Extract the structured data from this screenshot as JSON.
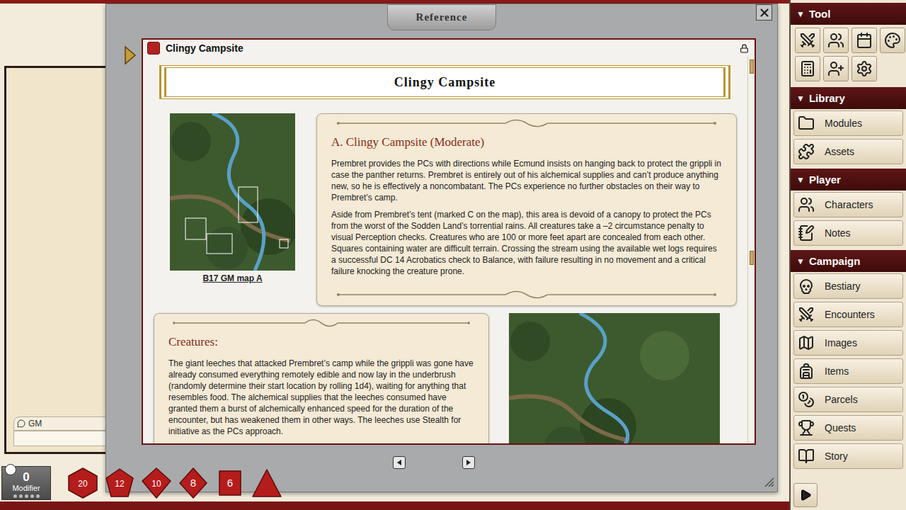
{
  "reference_window": {
    "title": "Reference"
  },
  "record": {
    "title": "Clingy Campsite",
    "locked": true,
    "banner": "Clingy Campsite",
    "map_caption": "B17 GM map A",
    "section_heading": "A. Clingy Campsite (Moderate)",
    "paragraphs": [
      "Prembret provides the PCs with directions while Ecmund insists on hanging back to protect the grippli in case the panther returns. Prembret is entirely out of his alchemical supplies and can’t produce anything new, so he is effectively a noncombatant. The PCs experience no further obstacles on their way to Prembret’s camp.",
      "Aside from Prembret’s tent (marked C on the map), this area is devoid of a canopy to protect the PCs from the worst of the Sodden Land’s torrential rains. All creatures take a –2 circumstance penalty to visual Perception checks. Creatures who are 100 or more feet apart are concealed from each other. Squares containing water are difficult terrain. Crossing the stream using the available wet logs requires a successful DC 14 Acrobatics check to Balance, with failure resulting in no movement and a critical failure knocking the creature prone."
    ],
    "creatures": {
      "heading": "Creatures:",
      "text": "The giant leeches that attacked Prembret’s camp while the grippli was gone have already consumed everything remotely edible and now lay in the underbrush (randomly determine their start location by rolling 1d4), waiting for anything that resembles food. The alchemical supplies that the leeches consumed have granted them a burst of alchemically enhanced speed for the duration of the encounter, but has weakened them in other ways. The leeches use Stealth for initiative as the PCs approach."
    }
  },
  "chat": {
    "speaker": "GM"
  },
  "modifier": {
    "value": "0",
    "label": "Modifier"
  },
  "dice": [
    {
      "kind": "d20",
      "label": "20"
    },
    {
      "kind": "d12",
      "label": "12"
    },
    {
      "kind": "d10",
      "label": "10"
    },
    {
      "kind": "d8",
      "label": "8"
    },
    {
      "kind": "d6",
      "label": "6"
    },
    {
      "kind": "d4",
      "label": ""
    }
  ],
  "sidebar": {
    "sections": [
      {
        "toggle": "▼",
        "title": "Tool",
        "expanded": true,
        "kind": "tools",
        "items": []
      },
      {
        "toggle": "▼",
        "title": "Library",
        "expanded": true,
        "kind": "list",
        "items": [
          "Modules",
          "Assets"
        ]
      },
      {
        "toggle": "▼",
        "title": "Player",
        "expanded": true,
        "kind": "list",
        "items": [
          "Characters",
          "Notes"
        ]
      },
      {
        "toggle": "▼",
        "title": "Campaign",
        "expanded": true,
        "kind": "list",
        "items": [
          "Bestiary",
          "Encounters",
          "Images",
          "Items",
          "Parcels",
          "Quests",
          "Story"
        ]
      }
    ]
  }
}
